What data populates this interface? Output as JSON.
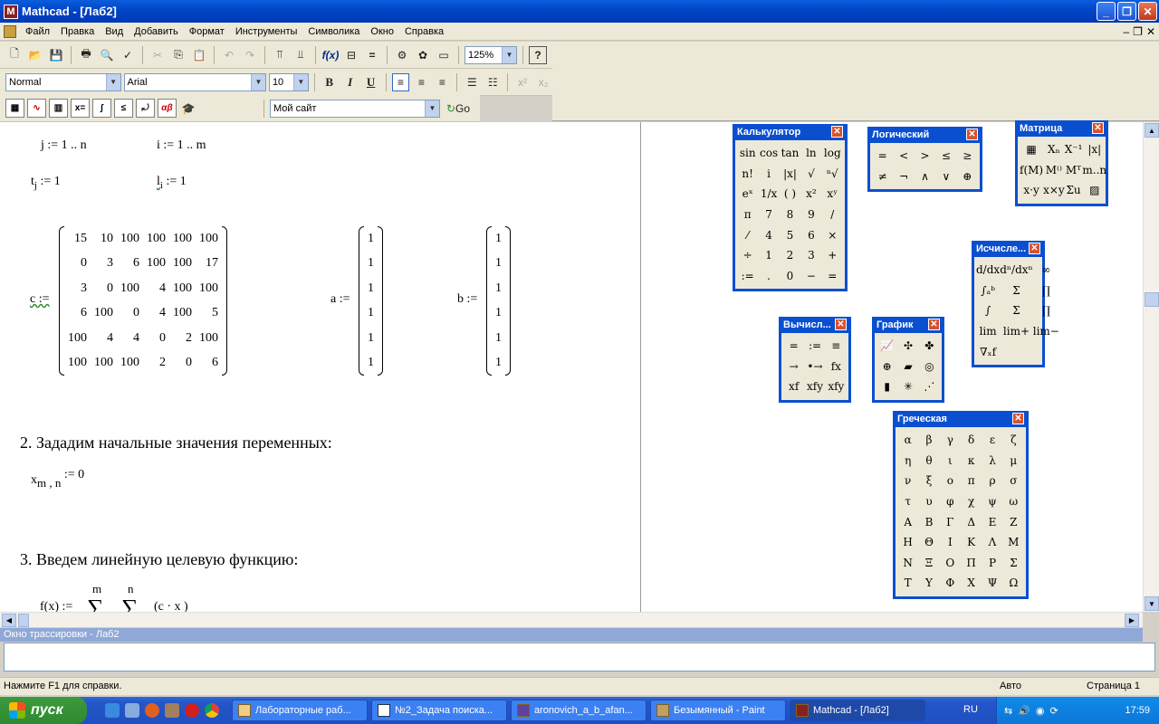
{
  "window": {
    "title": "Mathcad - [Лаб2]",
    "app_letter": "M"
  },
  "menu": [
    "Файл",
    "Правка",
    "Вид",
    "Добавить",
    "Формат",
    "Инструменты",
    "Символика",
    "Окно",
    "Справка"
  ],
  "toolbar": {
    "zoom": "125%",
    "style": "Normal",
    "font": "Arial",
    "size": "10",
    "bold": "B",
    "italic": "I",
    "underline": "U",
    "url": "Мой сайт",
    "go": "Go"
  },
  "doc": {
    "j_range": "j := 1 .. n",
    "i_range": "i := 1 .. m",
    "t_def": "t",
    "t_sub": "j",
    "t_rhs": ":= 1",
    "l_def": "l",
    "l_sub": "i",
    "l_rhs": ":= 1",
    "c_label": "c :=",
    "c_matrix": [
      [
        "15",
        "10",
        "100",
        "100",
        "100",
        "100"
      ],
      [
        "0",
        "3",
        "6",
        "100",
        "100",
        "17"
      ],
      [
        "3",
        "0",
        "100",
        "4",
        "100",
        "100"
      ],
      [
        "6",
        "100",
        "0",
        "4",
        "100",
        "5"
      ],
      [
        "100",
        "4",
        "4",
        "0",
        "2",
        "100"
      ],
      [
        "100",
        "100",
        "100",
        "2",
        "0",
        "6"
      ]
    ],
    "a_label": "a :=",
    "a_vec": [
      "1",
      "1",
      "1",
      "1",
      "1",
      "1"
    ],
    "b_label": "b :=",
    "b_vec": [
      "1",
      "1",
      "1",
      "1",
      "1",
      "1"
    ],
    "heading2": "2. Зададим начальные значения переменных:",
    "x_def": "x",
    "x_sub": "m , n",
    "x_rhs": ":= 0",
    "heading3": "3. Введем линейную целевую функцию:",
    "f_lhs": "f(x) :=",
    "f_sum_m": "m",
    "f_sum_n": "n",
    "f_sigma": "∑",
    "f_body": "(c  · x  )"
  },
  "palettes": {
    "calc": {
      "title": "Калькулятор",
      "cells": [
        "sin",
        "cos",
        "tan",
        "ln",
        "log",
        "n!",
        "i",
        "|x|",
        "√",
        "ⁿ√",
        "eˣ",
        "1/x",
        "( )",
        "x²",
        "xʸ",
        "π",
        "7",
        "8",
        "9",
        "/",
        "⁄",
        "4",
        "5",
        "6",
        "×",
        "÷",
        "1",
        "2",
        "3",
        "+",
        ":=",
        ".",
        "0",
        "−",
        "="
      ]
    },
    "logic": {
      "title": "Логический",
      "cells": [
        "=",
        "<",
        ">",
        "≤",
        "≥",
        "≠",
        "¬",
        "∧",
        "∨",
        "⊕"
      ]
    },
    "matrix": {
      "title": "Матрица",
      "cells": [
        "▦",
        "Xₙ",
        "X⁻¹",
        "|x|",
        "f(M)",
        "M⁽⁾",
        "Mᵀ",
        "m..n",
        "x·y",
        "x×y",
        "Σu",
        "▨"
      ]
    },
    "calculus": {
      "title": "Исчисле...",
      "cells": [
        "d/dx",
        "dⁿ/dxⁿ",
        "∞",
        "∫ₐᵇ",
        "Σ",
        "∏",
        "∫",
        "Σ",
        "∏",
        "lim",
        "lim+",
        "lim−",
        "∇ₓf"
      ]
    },
    "evaluate": {
      "title": "Вычисл...",
      "cells": [
        "=",
        ":=",
        "≡",
        "→",
        "•→",
        "fx",
        "xf",
        "xfy",
        "xfy"
      ]
    },
    "graph": {
      "title": "График",
      "cells": [
        "📈",
        "✣",
        "✤",
        "⊕",
        "▰",
        "◎",
        "▮",
        "✳",
        "⋰"
      ]
    },
    "greek": {
      "title": "Греческая",
      "cells": [
        "α",
        "β",
        "γ",
        "δ",
        "ε",
        "ζ",
        "η",
        "θ",
        "ι",
        "κ",
        "λ",
        "μ",
        "ν",
        "ξ",
        "ο",
        "π",
        "ρ",
        "σ",
        "τ",
        "υ",
        "φ",
        "χ",
        "ψ",
        "ω",
        "Α",
        "Β",
        "Γ",
        "Δ",
        "Ε",
        "Ζ",
        "Η",
        "Θ",
        "Ι",
        "Κ",
        "Λ",
        "Μ",
        "Ν",
        "Ξ",
        "Ο",
        "Π",
        "Ρ",
        "Σ",
        "Τ",
        "Υ",
        "Φ",
        "Χ",
        "Ψ",
        "Ω"
      ]
    }
  },
  "trace": {
    "title": "Окно трассировки - Лаб2"
  },
  "status": {
    "help": "Нажмите F1 для справки.",
    "mode": "Авто",
    "page": "Страница 1"
  },
  "taskbar": {
    "start": "пуск",
    "tasks": [
      "Лабораторные раб...",
      "№2_Задача поиска...",
      "aronovich_a_b_afan...",
      "Безымянный - Paint",
      "Mathcad - [Лаб2]"
    ],
    "lang": "RU",
    "clock": "17:59"
  }
}
